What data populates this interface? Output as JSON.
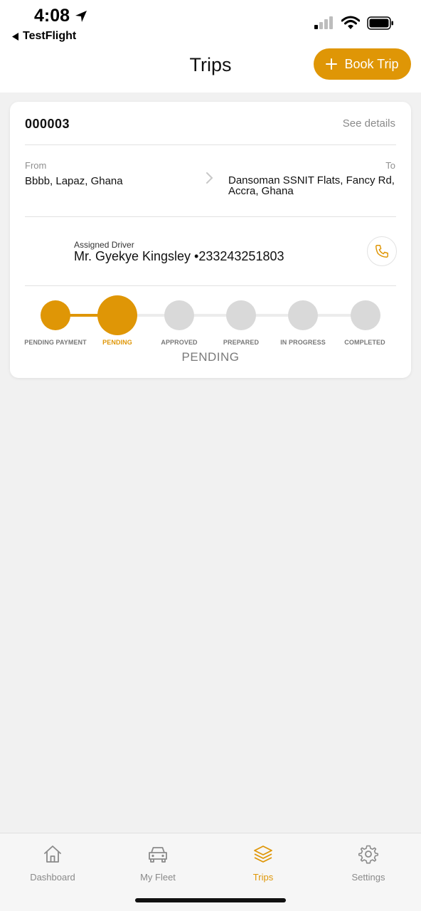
{
  "status_bar": {
    "time": "4:08",
    "back_app": "TestFlight",
    "icons": [
      "location-arrow-icon",
      "cellular-signal-icon",
      "wifi-icon",
      "battery-icon"
    ]
  },
  "header": {
    "title": "Trips",
    "book_button": "Book Trip"
  },
  "trip": {
    "id": "000003",
    "see_details": "See details",
    "from_label": "From",
    "from": "Bbbb, Lapaz, Ghana",
    "to_label": "To",
    "to": "Dansoman SSNIT Flats, Fancy Rd, Accra, Ghana",
    "driver_label": "Assigned Driver",
    "driver": "Mr. Gyekye Kingsley •233243251803",
    "steps": [
      "PENDING PAYMENT",
      "PENDING",
      "APPROVED",
      "PREPARED",
      "IN PROGRESS",
      "COMPLETED"
    ],
    "current_step": 1,
    "status": "PENDING"
  },
  "tabs": [
    {
      "label": "Dashboard",
      "icon": "home-icon"
    },
    {
      "label": "My Fleet",
      "icon": "car-icon"
    },
    {
      "label": "Trips",
      "icon": "layers-icon",
      "active": true
    },
    {
      "label": "Settings",
      "icon": "gear-icon"
    }
  ],
  "colors": {
    "accent": "#df9606",
    "inactive_step": "#d9d9d9",
    "background": "#f1f1f1"
  }
}
